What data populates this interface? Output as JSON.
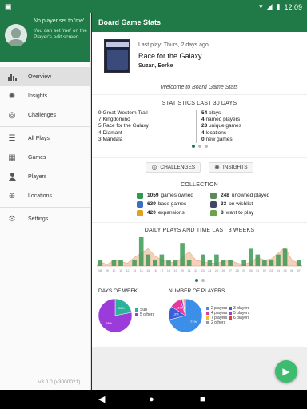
{
  "status_bar": {
    "left_icons": "notification-icon",
    "time": "12:09"
  },
  "drawer": {
    "header": {
      "line1": "No player set to 'me'",
      "line2": "You can set 'me' on the Player's edit screen."
    },
    "items": [
      {
        "label": "Overview",
        "icon": "bar-chart-icon"
      },
      {
        "label": "Insights",
        "icon": "lightbulb-icon"
      },
      {
        "label": "Challenges",
        "icon": "target-icon"
      },
      {
        "label": "All Plays",
        "icon": "list-icon"
      },
      {
        "label": "Games",
        "icon": "grid-icon"
      },
      {
        "label": "Players",
        "icon": "person-icon"
      },
      {
        "label": "Locations",
        "icon": "location-icon"
      },
      {
        "label": "Settings",
        "icon": "gear-icon"
      }
    ],
    "version": "v3.0.0 (v3000021)"
  },
  "appbar": {
    "title": "Board Game Stats"
  },
  "last_play": {
    "label": "Last play: Thurs, 2 days ago",
    "game": "Race for the Galaxy",
    "players": "Suzan, Eerke"
  },
  "welcome": "Welcome to Board Game Stats",
  "stats": {
    "title": "STATISTICS LAST 30 DAYS",
    "top_games": [
      {
        "count": "9",
        "name": "Great Western Trail"
      },
      {
        "count": "7",
        "name": "Kingdomino"
      },
      {
        "count": "5",
        "name": "Race for the Galaxy"
      },
      {
        "count": "4",
        "name": "Diamant"
      },
      {
        "count": "3",
        "name": "Mandala"
      }
    ],
    "totals": [
      {
        "count": "54",
        "label": "plays"
      },
      {
        "count": "4",
        "label": "named players"
      },
      {
        "count": "23",
        "label": "unique games"
      },
      {
        "count": "4",
        "label": "locations"
      },
      {
        "count": "0",
        "label": "new games"
      }
    ]
  },
  "buttons": {
    "challenges": "CHALLENGES",
    "insights": "INSIGHTS"
  },
  "collection": {
    "title": "COLLECTION",
    "left": [
      {
        "count": "1059",
        "label": "games owned",
        "color": "#2e9a4e"
      },
      {
        "count": "639",
        "label": "base games",
        "color": "#3a6fc4"
      },
      {
        "count": "420",
        "label": "expansions",
        "color": "#e0a020"
      }
    ],
    "right": [
      {
        "count": "248",
        "label": "unowned played",
        "color": "#5a8a5a"
      },
      {
        "count": "33",
        "label": "on wishlist",
        "color": "#444466"
      },
      {
        "count": "8",
        "label": "want to play",
        "color": "#6aa34a"
      }
    ]
  },
  "daily": {
    "title": "DAILY PLAYS AND TIME LAST 3 WEEKS",
    "x_labels": [
      "08",
      "09",
      "10",
      "11",
      "12",
      "13",
      "14",
      "15",
      "16",
      "17",
      "18",
      "19",
      "20",
      "21",
      "22",
      "23",
      "24",
      "25",
      "26",
      "27",
      "28",
      "29",
      "30",
      "01",
      "02",
      "03",
      "04",
      "05",
      "06",
      "07"
    ],
    "plays": [
      1,
      0,
      1,
      1,
      0,
      1,
      5,
      2,
      1,
      2,
      1,
      1,
      4,
      1,
      0,
      2,
      1,
      2,
      1,
      1,
      0,
      1,
      3,
      2,
      1,
      1,
      2,
      3,
      0,
      1
    ],
    "time": [
      0.15,
      0.05,
      0.2,
      0.15,
      0.1,
      0.3,
      0.45,
      0.6,
      0.35,
      0.2,
      0.15,
      0.1,
      0.3,
      0.5,
      0.2,
      0.15,
      0.1,
      0.1,
      0.15,
      0.2,
      0.1,
      0.05,
      0.15,
      0.3,
      0.2,
      0.25,
      0.45,
      0.65,
      0.2,
      0.1
    ],
    "bar_color": "#3a9a55",
    "area_color": "#f3c6a8"
  },
  "days_of_week": {
    "title": "DAYS OF WEEK",
    "slices": [
      {
        "label": "Sun",
        "value": 22,
        "color": "#2ab39a"
      },
      {
        "label": "5 others",
        "value": 78,
        "color": "#9b3bd9"
      }
    ]
  },
  "number_of_players": {
    "title": "NUMBER OF PLAYERS",
    "slices": [
      {
        "label": "2 players",
        "value": 71,
        "color": "#3b8fe8"
      },
      {
        "label": "3 players",
        "value": 13,
        "color": "#3b5fd9"
      },
      {
        "label": "4 players",
        "value": 11,
        "color": "#e8399a"
      },
      {
        "label": "5 players",
        "value": 2,
        "color": "#9b3bd9"
      },
      {
        "label": "7 players",
        "value": 1,
        "color": "#e8c23b"
      },
      {
        "label": "6 players",
        "value": 1,
        "color": "#e83b3b"
      },
      {
        "label": "2 others",
        "value": 1,
        "color": "#999999"
      }
    ]
  },
  "fab": {
    "icon": "play-icon"
  },
  "nav_bar": {
    "back": "back-icon",
    "home": "home-icon",
    "recents": "recents-icon"
  }
}
